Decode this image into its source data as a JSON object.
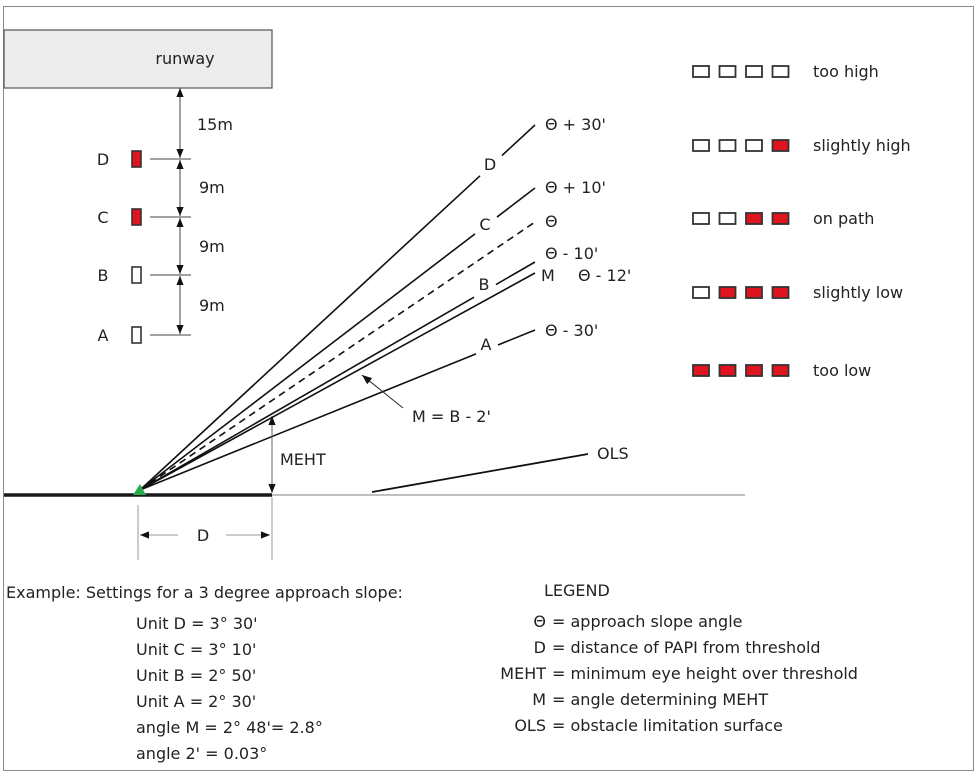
{
  "colors": {
    "red_light": "#e0141e",
    "white_light": "#ffffff",
    "light_border": "#333333",
    "runway_fill": "#ececec",
    "papi_marker": "#2aa84a",
    "thin_line": "#999999"
  },
  "runway": {
    "label": "runway"
  },
  "papi_units": [
    {
      "id": "D",
      "lit": "red"
    },
    {
      "id": "C",
      "lit": "red"
    },
    {
      "id": "B",
      "lit": "white"
    },
    {
      "id": "A",
      "lit": "white"
    }
  ],
  "spacing": {
    "runway_to_D": "15m",
    "D_to_C": "9m",
    "C_to_B": "9m",
    "B_to_A": "9m"
  },
  "beams": [
    {
      "unit": "D",
      "label": "D",
      "angle_label": "Θ + 30'"
    },
    {
      "unit": "C",
      "label": "C",
      "angle_label": "Θ + 10'"
    },
    {
      "unit": "approach",
      "label": "",
      "angle_label": "Θ",
      "dashed": true
    },
    {
      "unit": "B",
      "label": "B",
      "angle_label": "Θ - 10'"
    },
    {
      "unit": "M",
      "label": "M",
      "angle_label": "Θ - 12'"
    },
    {
      "unit": "A",
      "label": "A",
      "angle_label": "Θ - 30'"
    }
  ],
  "annotations": {
    "m_formula": "M = B - 2'",
    "meht": "MEHT",
    "ols": "OLS",
    "distance": "D"
  },
  "indications": [
    {
      "label": "too high",
      "lights": [
        "white",
        "white",
        "white",
        "white"
      ]
    },
    {
      "label": "slightly high",
      "lights": [
        "white",
        "white",
        "white",
        "red"
      ]
    },
    {
      "label": "on path",
      "lights": [
        "white",
        "white",
        "red",
        "red"
      ]
    },
    {
      "label": "slightly low",
      "lights": [
        "white",
        "red",
        "red",
        "red"
      ]
    },
    {
      "label": "too low",
      "lights": [
        "red",
        "red",
        "red",
        "red"
      ]
    }
  ],
  "example": {
    "heading": "Example:  Settings for a 3 degree approach slope:",
    "lines": [
      "Unit D = 3° 30'",
      "Unit C = 3° 10'",
      "Unit B = 2° 50'",
      "Unit A = 2° 30'",
      "angle M = 2° 48'= 2.8°",
      "angle 2' = 0.03°"
    ]
  },
  "legend": {
    "heading": "LEGEND",
    "items": [
      {
        "key": "Θ",
        "value": "= approach slope angle"
      },
      {
        "key": "D",
        "value": "= distance of PAPI from threshold"
      },
      {
        "key": "MEHT",
        "value": "= minimum eye height over threshold"
      },
      {
        "key": "M",
        "value": "= angle determining MEHT"
      },
      {
        "key": "OLS",
        "value": "= obstacle limitation surface"
      }
    ]
  }
}
